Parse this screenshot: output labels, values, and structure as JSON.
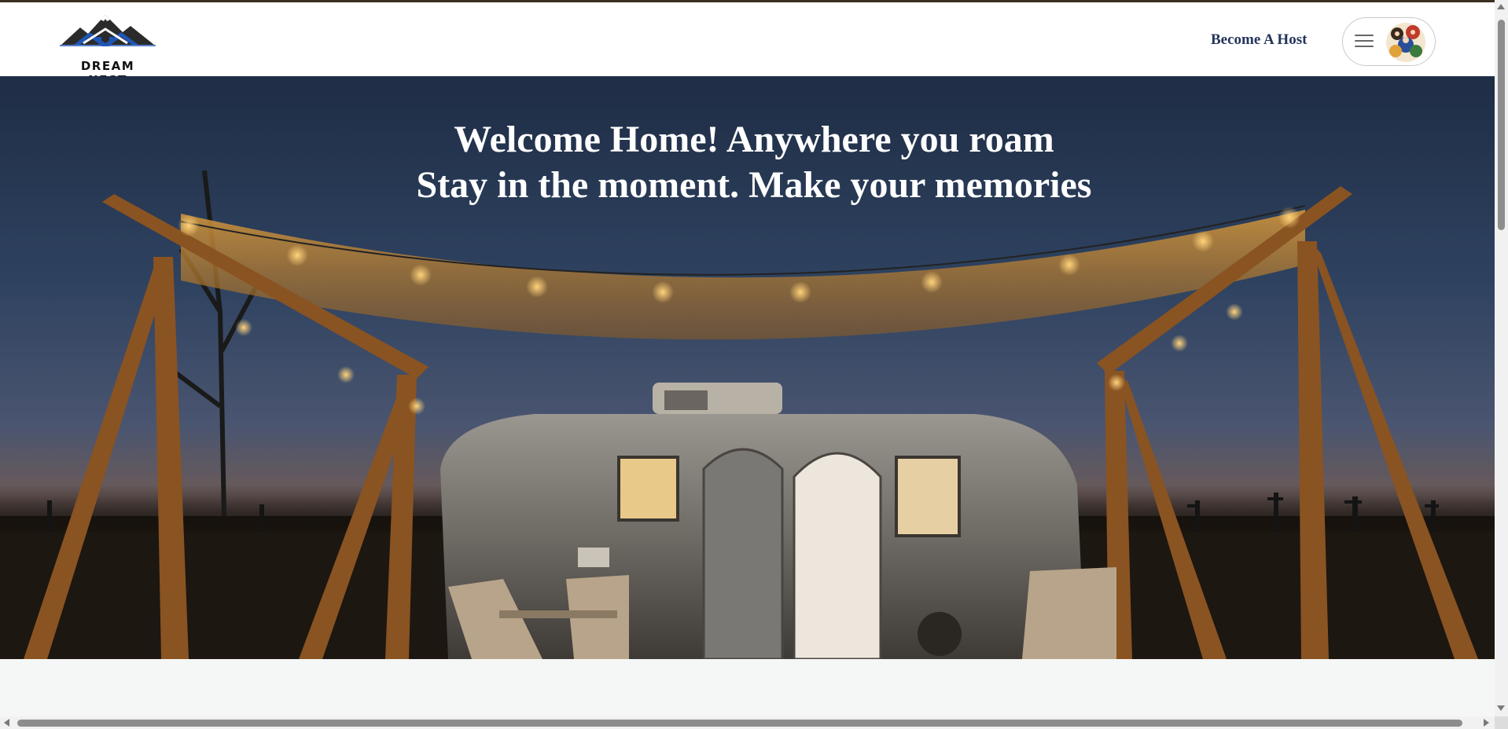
{
  "brand": {
    "name": "DREAM NEST"
  },
  "nav": {
    "host_link": "Become A Host"
  },
  "hero": {
    "line1": "Welcome Home! Anywhere you roam",
    "line2": "Stay in the moment. Make your memories"
  },
  "icons": {
    "menu": "hamburger-menu-icon",
    "avatar": "user-avatar",
    "logo": "mountain-house-logo"
  },
  "colors": {
    "host_link": "#24355c",
    "logo_blue": "#1f56b5",
    "hero_text": "#ffffff"
  }
}
